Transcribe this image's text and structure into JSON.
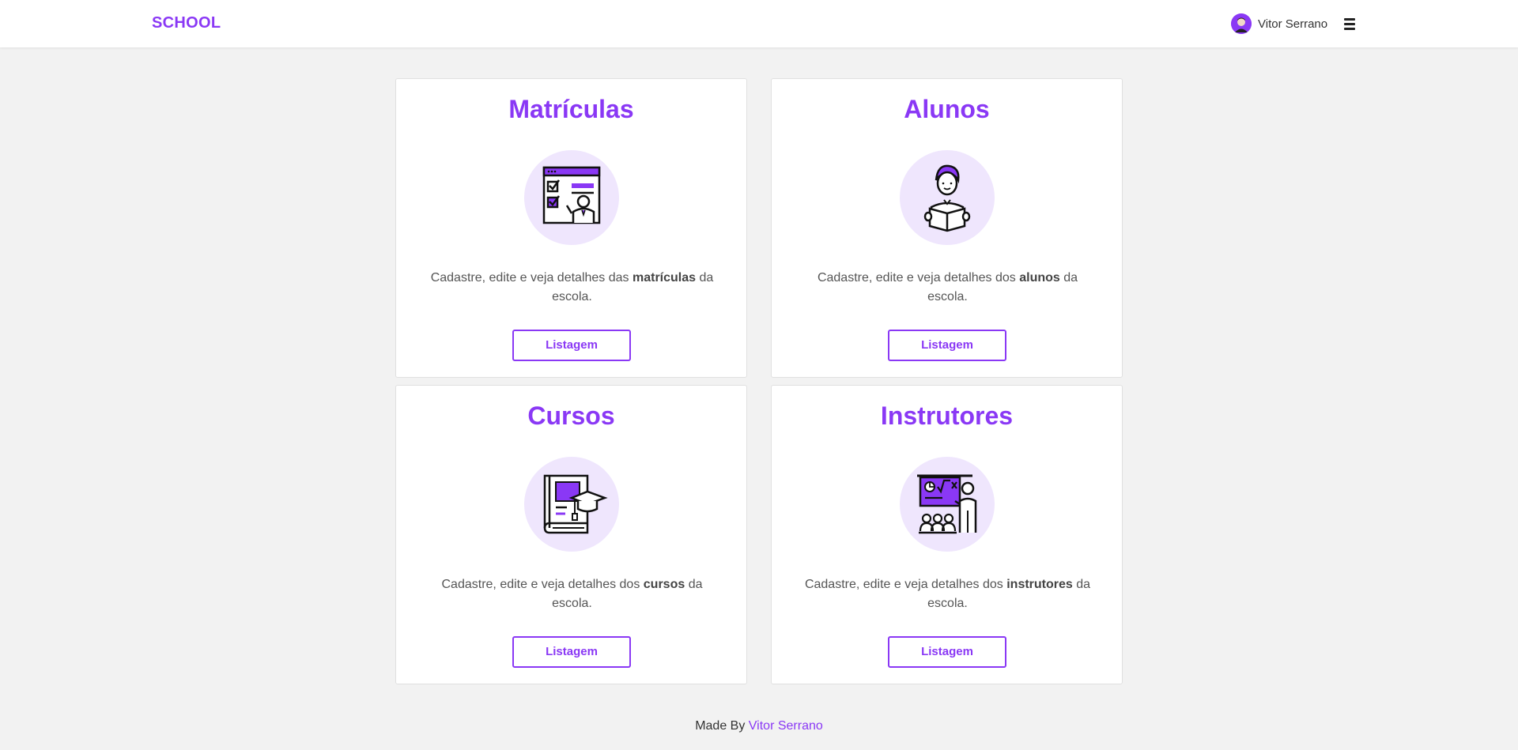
{
  "navbar": {
    "brand": "SCHOOL",
    "user_name": "Vitor Serrano",
    "menu_icon": "hamburger-icon",
    "avatar_icon": "user-avatar-icon"
  },
  "cards": [
    {
      "title": "Matrículas",
      "desc_pre": "Cadastre, edite e veja detalhes das ",
      "desc_bold": "matrículas",
      "desc_post": " da escola.",
      "button": "Listagem",
      "icon": "enrollment-board-icon"
    },
    {
      "title": "Alunos",
      "desc_pre": "Cadastre, edite e veja detalhes dos ",
      "desc_bold": "alunos",
      "desc_post": " da escola.",
      "button": "Listagem",
      "icon": "student-reading-icon"
    },
    {
      "title": "Cursos",
      "desc_pre": "Cadastre, edite e veja detalhes dos ",
      "desc_bold": "cursos",
      "desc_post": " da escola.",
      "button": "Listagem",
      "icon": "book-graduation-cap-icon"
    },
    {
      "title": "Instrutores",
      "desc_pre": "Cadastre, edite e veja detalhes dos ",
      "desc_bold": "instrutores",
      "desc_post": " da escola.",
      "button": "Listagem",
      "icon": "instructor-class-icon"
    }
  ],
  "footer": {
    "made_by": "Made By ",
    "author": "Vitor Serrano"
  },
  "colors": {
    "accent": "#8a38f5",
    "icon_circle": "#efe6fd",
    "background": "#f2f2f2"
  }
}
